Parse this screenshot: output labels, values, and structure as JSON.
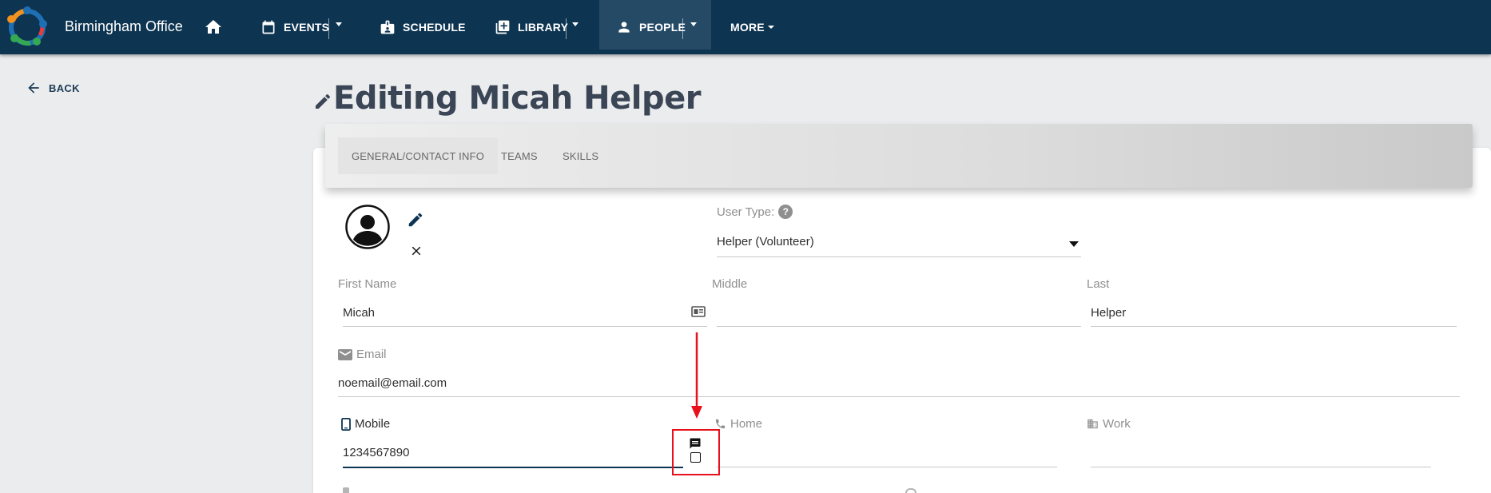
{
  "app": {
    "org_name": "Birmingham Office"
  },
  "nav": {
    "events": "EVENTS",
    "schedule": "SCHEDULE",
    "library": "LIBRARY",
    "people": "PEOPLE",
    "more": "MORE"
  },
  "back_label": "BACK",
  "page_title": "Editing Micah Helper",
  "tabs": [
    {
      "label": "GENERAL/CONTACT INFO",
      "active": true
    },
    {
      "label": "TEAMS",
      "active": false
    },
    {
      "label": "SKILLS",
      "active": false
    }
  ],
  "form": {
    "user_type_label": "User Type:",
    "user_type_value": "Helper (Volunteer)",
    "first_name_label": "First Name",
    "first_name_value": "Micah",
    "middle_label": "Middle",
    "middle_value": "",
    "last_label": "Last",
    "last_value": "Helper",
    "email_label": "Email",
    "email_value": "noemail@email.com",
    "mobile_label": "Mobile",
    "mobile_value": "1234567890",
    "home_label": "Home",
    "home_value": "",
    "work_label": "Work",
    "work_value": ""
  },
  "icons": {
    "home": "home-icon",
    "events": "calendar-icon",
    "schedule": "badge-icon",
    "library": "library-add-icon",
    "people": "person-icon",
    "back": "arrow-left-icon",
    "title": "pencil-icon",
    "avatar": "account-circle-icon",
    "edit_photo": "pencil-icon",
    "clear_photo": "close-icon",
    "help": "question-circle-icon",
    "contact_card": "contact-card-icon",
    "email": "envelope-icon",
    "mobile": "cellphone-icon",
    "home_phone": "phone-icon",
    "work": "office-building-icon",
    "sms": "message-icon",
    "sms_checkbox": "checkbox-icon"
  },
  "colors": {
    "topbar": "#0d3451",
    "people_active": "#244a66",
    "page_background": "#ebeced",
    "title": "#3a4556",
    "annotation": "#e8101d",
    "focus_underline": "#0d3451"
  }
}
